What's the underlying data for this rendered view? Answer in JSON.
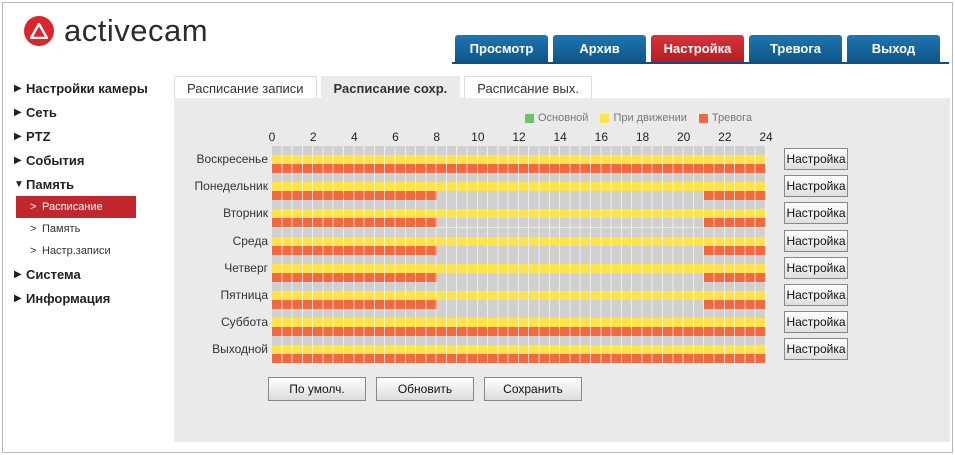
{
  "brand": {
    "name": "activecam"
  },
  "nav": [
    "Просмотр",
    "Архив",
    "Настройка",
    "Тревога",
    "Выход"
  ],
  "nav_active": 2,
  "sidebar": {
    "items": [
      {
        "label": "Настройки камеры",
        "expanded": false
      },
      {
        "label": "Сеть",
        "expanded": false
      },
      {
        "label": "PTZ",
        "expanded": false
      },
      {
        "label": "События",
        "expanded": false
      },
      {
        "label": "Память",
        "expanded": true,
        "children": [
          {
            "label": "Расписание",
            "active": true
          },
          {
            "label": "Память",
            "active": false
          },
          {
            "label": "Настр.записи",
            "active": false
          }
        ]
      },
      {
        "label": "Система",
        "expanded": false
      },
      {
        "label": "Информация",
        "expanded": false
      }
    ]
  },
  "subtabs": [
    "Расписание записи",
    "Расписание сохр.",
    "Расписание вых."
  ],
  "subtab_active": 1,
  "legend": [
    {
      "label": "Основной",
      "color": "#6cc46a"
    },
    {
      "label": "При движении",
      "color": "#ffe34a"
    },
    {
      "label": "Тревога",
      "color": "#f26841"
    }
  ],
  "hours": [
    "0",
    "2",
    "4",
    "6",
    "8",
    "10",
    "12",
    "14",
    "16",
    "18",
    "20",
    "22",
    "24"
  ],
  "colors": {
    "gray": "#d0d0d0",
    "yellow": "#ffe34a",
    "red": "#f26841"
  },
  "days": [
    {
      "label": "Воскресенье",
      "schedule": {
        "motion": [
          [
            0,
            24
          ]
        ],
        "alarm": [
          [
            0,
            24
          ]
        ]
      }
    },
    {
      "label": "Понедельник",
      "schedule": {
        "motion": [
          [
            0,
            24
          ]
        ],
        "alarm": [
          [
            0,
            8
          ],
          [
            21,
            24
          ]
        ]
      }
    },
    {
      "label": "Вторник",
      "schedule": {
        "motion": [
          [
            0,
            24
          ]
        ],
        "alarm": [
          [
            0,
            8
          ],
          [
            21,
            24
          ]
        ]
      }
    },
    {
      "label": "Среда",
      "schedule": {
        "motion": [
          [
            0,
            24
          ]
        ],
        "alarm": [
          [
            0,
            8
          ],
          [
            21,
            24
          ]
        ]
      }
    },
    {
      "label": "Четверг",
      "schedule": {
        "motion": [
          [
            0,
            24
          ]
        ],
        "alarm": [
          [
            0,
            8
          ],
          [
            21,
            24
          ]
        ]
      }
    },
    {
      "label": "Пятница",
      "schedule": {
        "motion": [
          [
            0,
            24
          ]
        ],
        "alarm": [
          [
            0,
            8
          ],
          [
            21,
            24
          ]
        ]
      }
    },
    {
      "label": "Суббота",
      "schedule": {
        "motion": [
          [
            0,
            24
          ]
        ],
        "alarm": [
          [
            0,
            24
          ]
        ]
      }
    },
    {
      "label": "Выходной",
      "schedule": {
        "motion": [
          [
            0,
            24
          ]
        ],
        "alarm": [
          [
            0,
            24
          ]
        ]
      }
    }
  ],
  "config_button_label": "Настройка",
  "buttons": {
    "default": "По умолч.",
    "refresh": "Обновить",
    "save": "Сохранить"
  }
}
